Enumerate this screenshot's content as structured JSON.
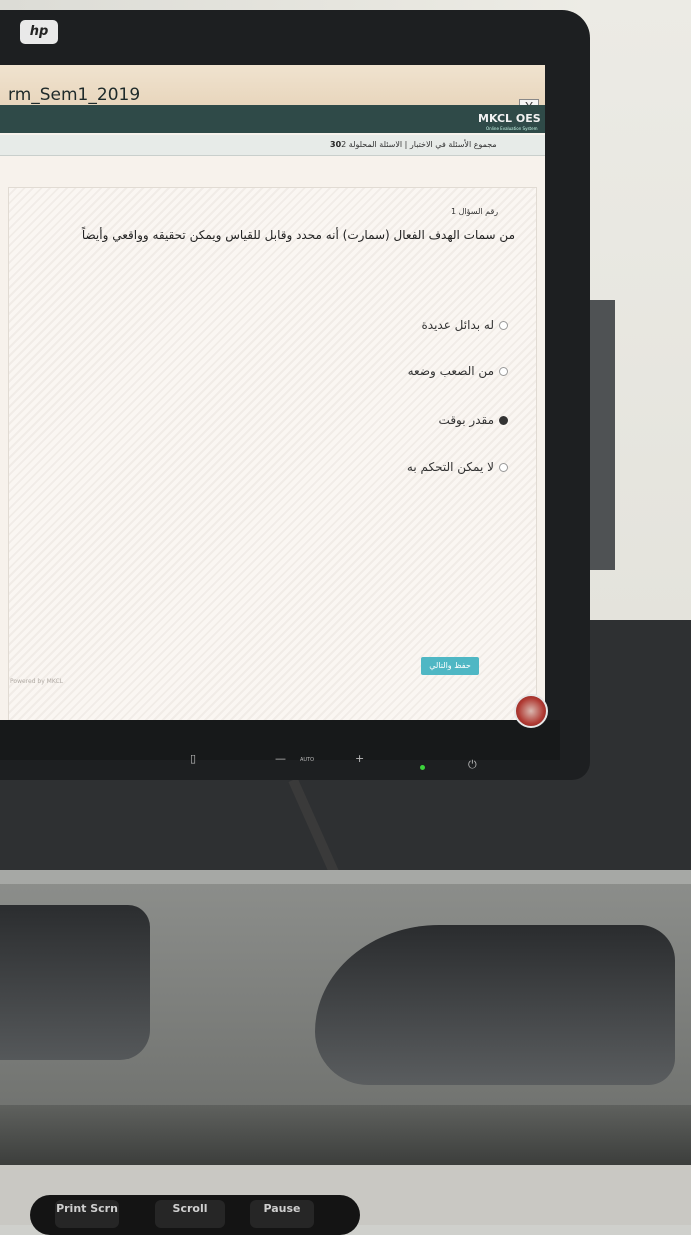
{
  "monitor": {
    "brand_logo": "hp",
    "controls": [
      "▯",
      "—",
      "AUTO",
      "+",
      "⏻"
    ],
    "colors": {
      "bezel": "#1d1f21",
      "power_led": "#3cd33c"
    }
  },
  "window": {
    "title": "rm_Sem1_2019",
    "close_label": "X",
    "brand": "MKCL OES",
    "brand_sub": "Online Evaluation System"
  },
  "exam": {
    "info_count": "30",
    "info_text": "مجموع الأسئلة في الاختبار | الاسئلة المحلولة 2",
    "question_label": "رقم السؤال 1",
    "question_text": "من سمات الهدف الفعال (سمارت) أنه محدد وقابل للقياس ويمكن تحقيقه وواقعي وأيضاً",
    "options": [
      {
        "label": "له بدائل عديدة",
        "selected": false
      },
      {
        "label": "من الصعب وضعه",
        "selected": false
      },
      {
        "label": "مقدر بوقت",
        "selected": true
      },
      {
        "label": "لا يمكن التحكم به",
        "selected": false
      }
    ],
    "save_button": "حفظ والتالي",
    "footer": "Powered by MKCL",
    "colors": {
      "brand_bar": "#2f4a48",
      "save_button": "#4fb7c4"
    }
  },
  "keyboard": {
    "keys": [
      "Print Scrn",
      "Scroll",
      "Pause"
    ]
  }
}
